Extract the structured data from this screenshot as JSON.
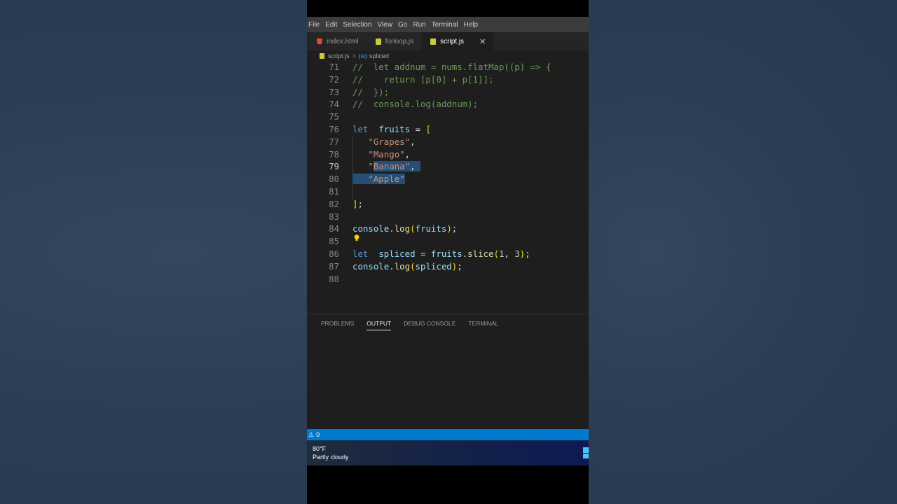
{
  "menubar": [
    "File",
    "Edit",
    "Selection",
    "View",
    "Go",
    "Run",
    "Terminal",
    "Help"
  ],
  "tabs": [
    {
      "label": "index.html",
      "icon": "html-file-icon",
      "active": false
    },
    {
      "label": "forloop.js",
      "icon": "js-file-icon",
      "active": false
    },
    {
      "label": "script.js",
      "icon": "js-file-icon",
      "active": true
    }
  ],
  "tab_close_glyph": "✕",
  "breadcrumb": {
    "file": "script.js",
    "sep": ">",
    "symbol_icon": "(⊙)",
    "symbol": "spliced"
  },
  "editor": {
    "lines": [
      {
        "n": "71",
        "tokens": [
          [
            "cm",
            "//  let addnum = nums.flatMap((p) => {"
          ]
        ]
      },
      {
        "n": "72",
        "tokens": [
          [
            "cm",
            "//    return [p[0] + p[1]];"
          ]
        ]
      },
      {
        "n": "73",
        "tokens": [
          [
            "cm",
            "//  });"
          ]
        ]
      },
      {
        "n": "74",
        "tokens": [
          [
            "cm",
            "//  console.log(addnum);"
          ]
        ]
      },
      {
        "n": "75",
        "tokens": []
      },
      {
        "n": "76",
        "tokens": [
          [
            "kw",
            "let"
          ],
          [
            "",
            "  "
          ],
          [
            "var",
            "fruits"
          ],
          [
            "",
            " = "
          ],
          [
            "br",
            "["
          ]
        ]
      },
      {
        "n": "77",
        "tokens": [
          [
            "",
            "   "
          ],
          [
            "str",
            "\"Grapes\""
          ],
          [
            "",
            ","
          ]
        ]
      },
      {
        "n": "78",
        "tokens": [
          [
            "",
            "   "
          ],
          [
            "str",
            "\"Mango\""
          ],
          [
            "",
            ","
          ]
        ]
      },
      {
        "n": "79",
        "tokens": [
          [
            "",
            "   "
          ],
          [
            "str",
            "\""
          ],
          [
            "str sel",
            "Banana\""
          ],
          [
            "sel",
            ", "
          ]
        ]
      },
      {
        "n": "80",
        "tokens": [
          [
            "sel",
            "   "
          ],
          [
            "str sel",
            "\"Apple\""
          ]
        ]
      },
      {
        "n": "81",
        "tokens": []
      },
      {
        "n": "82",
        "tokens": [
          [
            "br",
            "]"
          ],
          [
            "",
            ";"
          ]
        ]
      },
      {
        "n": "83",
        "tokens": []
      },
      {
        "n": "84",
        "tokens": [
          [
            "var",
            "console"
          ],
          [
            "",
            "."
          ],
          [
            "fn",
            "log"
          ],
          [
            "br",
            "("
          ],
          [
            "var",
            "fruits"
          ],
          [
            "br",
            ")"
          ],
          [
            "",
            ";"
          ]
        ]
      },
      {
        "n": "85",
        "tokens": []
      },
      {
        "n": "86",
        "tokens": [
          [
            "kw",
            "let"
          ],
          [
            "",
            "  "
          ],
          [
            "var",
            "spliced"
          ],
          [
            "",
            " = "
          ],
          [
            "var",
            "fruits"
          ],
          [
            "",
            "."
          ],
          [
            "fn",
            "slice"
          ],
          [
            "br",
            "("
          ],
          [
            "num",
            "1"
          ],
          [
            "",
            ", "
          ],
          [
            "num",
            "3"
          ],
          [
            "br",
            ")"
          ],
          [
            "",
            ";"
          ]
        ]
      },
      {
        "n": "87",
        "tokens": [
          [
            "var",
            "console"
          ],
          [
            "",
            "."
          ],
          [
            "fn",
            "log"
          ],
          [
            "br",
            "("
          ],
          [
            "var",
            "spliced"
          ],
          [
            "br",
            ")"
          ],
          [
            "",
            ";"
          ]
        ]
      },
      {
        "n": "88",
        "tokens": []
      }
    ],
    "current_line": "79"
  },
  "panel_tabs": [
    {
      "label": "PROBLEMS",
      "active": false
    },
    {
      "label": "OUTPUT",
      "active": true
    },
    {
      "label": "DEBUG CONSOLE",
      "active": false
    },
    {
      "label": "TERMINAL",
      "active": false
    }
  ],
  "statusbar": {
    "warning_icon": "⚠",
    "count": "0"
  },
  "taskbar": {
    "temperature": "80°F",
    "condition": "Partly cloudy"
  },
  "colors": {
    "statusbar": "#007acc",
    "editor_bg": "#1e1e1e",
    "selection": "#264f78"
  }
}
